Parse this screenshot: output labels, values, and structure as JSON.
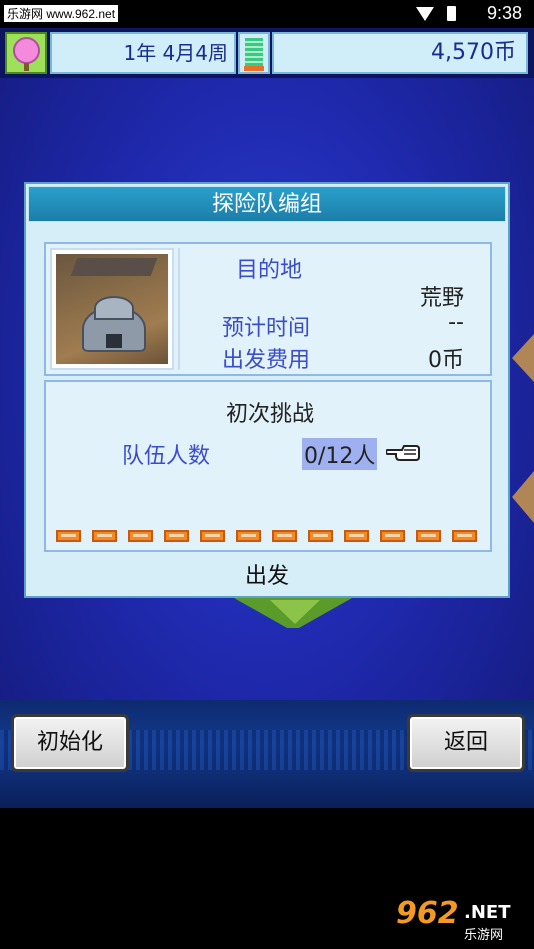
{
  "statusbar": {
    "watermark": "乐游网 www.962.net",
    "time": "9:38"
  },
  "hud": {
    "date": "1年 4月4周",
    "money": "4,570币"
  },
  "dialog": {
    "title": "探险队编组",
    "destination_label": "目的地",
    "destination_value": "荒野",
    "time_label": "预计时间",
    "time_value": "--",
    "cost_label": "出发费用",
    "cost_value": "0币",
    "challenge": "初次挑战",
    "team_label": "队伍人数",
    "team_value": "0/12人",
    "slot_count": 12,
    "depart": "出发"
  },
  "bottom": {
    "init_label": "初始化",
    "back_label": "返回"
  },
  "logo": {
    "big": "962",
    "net": ".NET",
    "sub": "乐游网"
  },
  "colors": {
    "label_blue": "#3b4dc8",
    "title_bar": "#1b7ea8",
    "slot_orange": "#f08a2a"
  }
}
